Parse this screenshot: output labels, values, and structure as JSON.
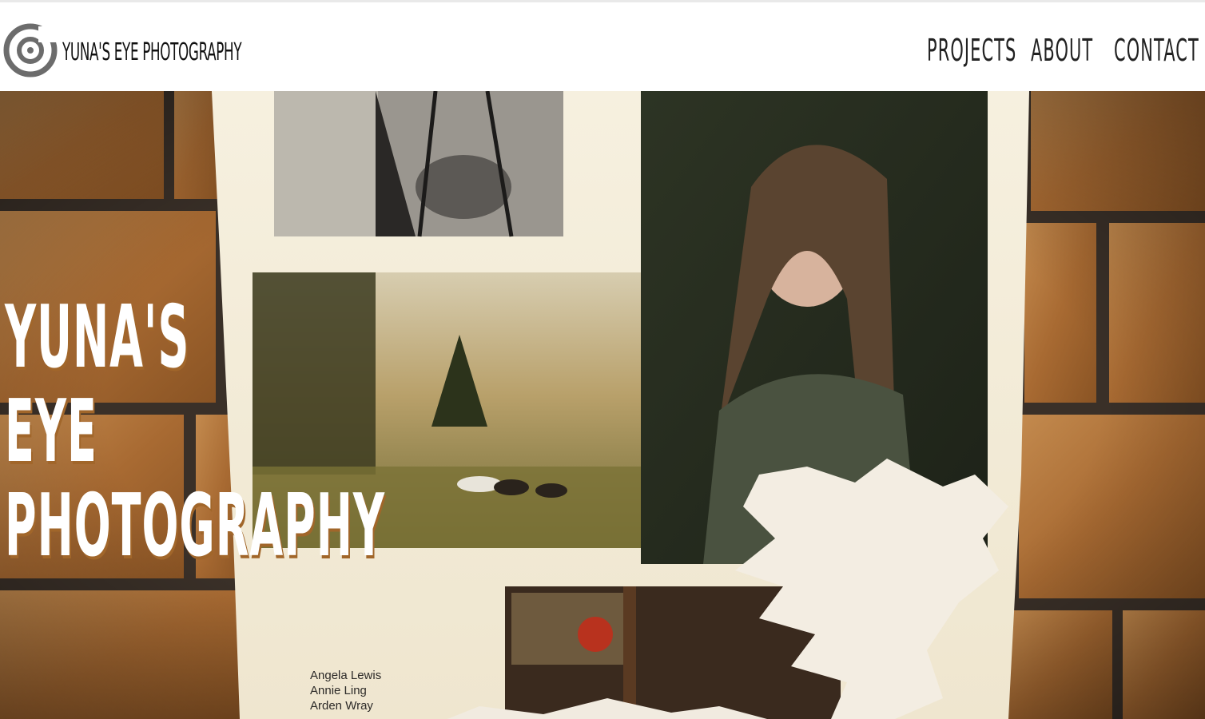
{
  "site": {
    "brand": "Yuna's Eye Photography",
    "logo_icon": "eye-logo-icon"
  },
  "nav": {
    "items": [
      {
        "label": "Projects"
      },
      {
        "label": "About"
      },
      {
        "label": "Contact"
      }
    ]
  },
  "hero": {
    "title_lines": [
      "Yuna's",
      "Eye",
      "Photography"
    ],
    "credits": [
      "Angela Lewis",
      "Annie Ling",
      "Arden Wray"
    ]
  },
  "colors": {
    "accent_shadow": "#a1662a",
    "brick": "#b07238",
    "mortar": "#3a3028",
    "paper": "#f4efe0"
  }
}
